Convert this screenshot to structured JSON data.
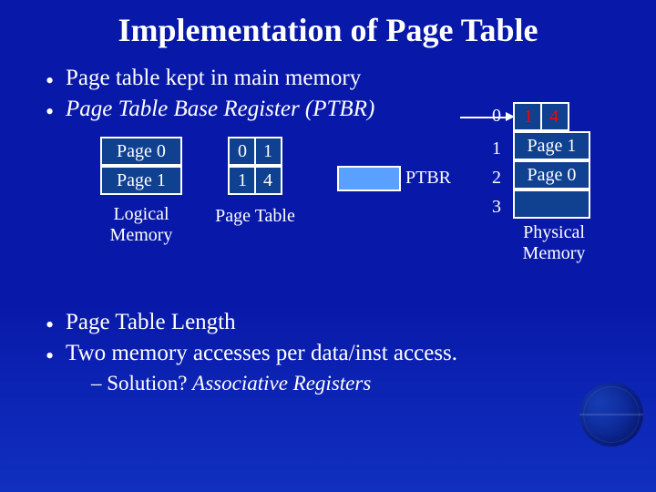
{
  "title": "Implementation of Page Table",
  "bullets_top": [
    "Page table kept in main memory",
    "Page Table Base Register (PTBR)"
  ],
  "bullets_bottom": [
    "Page Table Length",
    "Two memory accesses per data/inst access."
  ],
  "sub_bullet": "– Solution? Associative Registers",
  "logical_memory": {
    "label": "Logical\nMemory",
    "pages": [
      "Page 0",
      "Page 1"
    ]
  },
  "page_table": {
    "label": "Page Table",
    "rows": [
      {
        "valid": "0",
        "frame": "1"
      },
      {
        "valid": "1",
        "frame": "4"
      }
    ]
  },
  "ptbr": {
    "label": "PTBR"
  },
  "physical_memory": {
    "label": "Physical\nMemory",
    "indices": [
      "0",
      "1",
      "2",
      "3"
    ],
    "frames": [
      "",
      "Page 1",
      "Page 0",
      ""
    ],
    "ptr_row": {
      "a": "1",
      "b": "4"
    }
  }
}
